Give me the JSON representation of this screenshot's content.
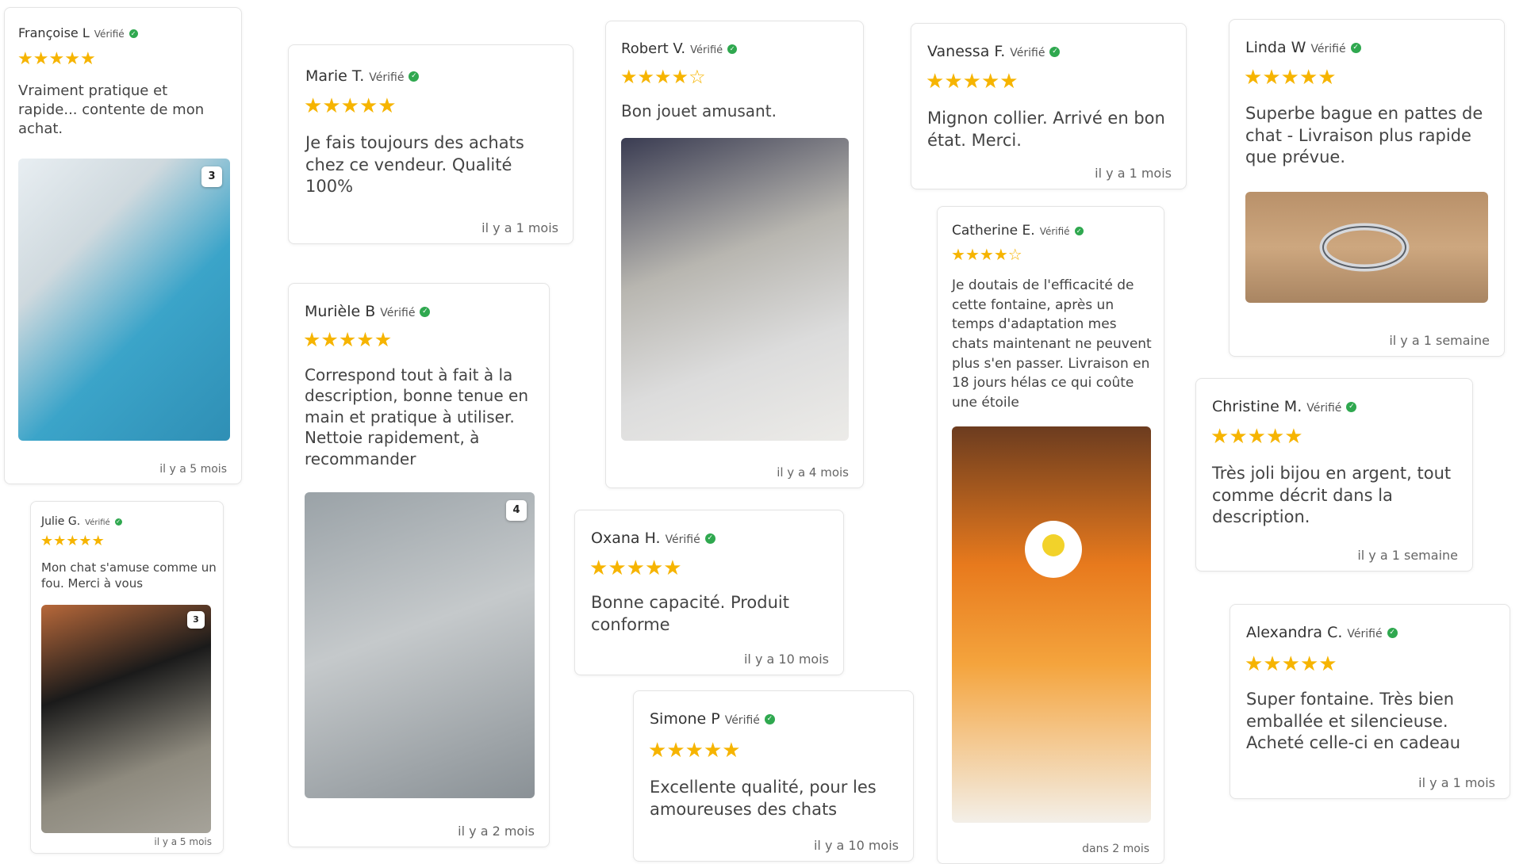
{
  "verified_label": "Vérifié",
  "reviews": [
    {
      "name": "Françoise L",
      "rating": 5,
      "text": "Vraiment pratique et rapide... contente de mon achat.",
      "date": "il y a 5 mois",
      "badge": "3"
    },
    {
      "name": "Marie T.",
      "rating": 5,
      "text": "Je fais toujours des achats chez ce vendeur. Qualité 100%",
      "date": "il y a 1 mois"
    },
    {
      "name": "Robert V.",
      "rating": 4,
      "text": "Bon jouet amusant.",
      "date": "il y a 4 mois"
    },
    {
      "name": "Vanessa F.",
      "rating": 5,
      "text": "Mignon collier. Arrivé en bon état. Merci.",
      "date": "il y a 1 mois"
    },
    {
      "name": "Linda W",
      "rating": 5,
      "text": "Superbe bague en pattes de chat - Livraison plus rapide que prévue.",
      "date": "il y a 1 semaine"
    },
    {
      "name": "Murièle B",
      "rating": 5,
      "text": "Correspond tout à fait à la description, bonne tenue en main et pratique à utiliser. Nettoie rapidement, à recommander",
      "date": "il y a 2 mois",
      "badge": "4"
    },
    {
      "name": "Catherine E.",
      "rating": 4,
      "text": "Je doutais de l'efficacité de cette fontaine, après un temps d'adaptation mes chats maintenant ne peuvent plus s'en passer. Livraison en 18 jours hélas ce qui coûte une étoile",
      "date": "dans 2 mois"
    },
    {
      "name": "Julie G.",
      "rating": 5,
      "text": "Mon chat s'amuse comme un fou. Merci à vous",
      "date": "il y a 5 mois",
      "badge": "3"
    },
    {
      "name": "Oxana H.",
      "rating": 5,
      "text": "Bonne capacité. Produit conforme",
      "date": "il y a 10 mois"
    },
    {
      "name": "Christine M.",
      "rating": 5,
      "text": "Très joli bijou en argent, tout comme décrit dans la description.",
      "date": "il y a 1 semaine"
    },
    {
      "name": "Simone P",
      "rating": 5,
      "text": "Excellente qualité, pour les amoureuses des chats",
      "date": "il y a 10 mois"
    },
    {
      "name": "Alexandra C.",
      "rating": 5,
      "text": "Super fontaine. Très bien emballée et silencieuse. Acheté celle-ci en cadeau",
      "date": "il y a 1 mois"
    }
  ]
}
